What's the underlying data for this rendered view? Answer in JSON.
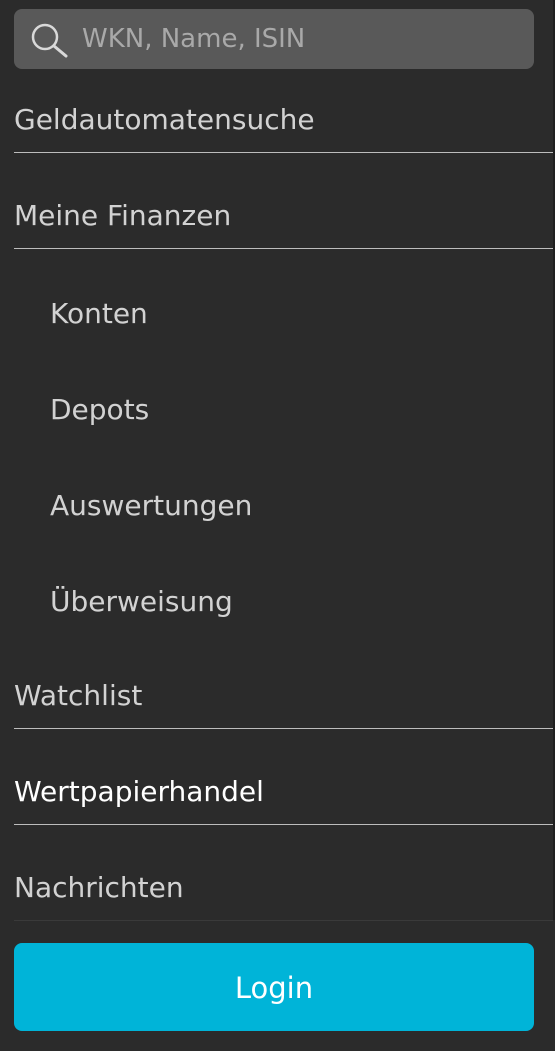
{
  "search": {
    "placeholder": "WKN, Name, ISIN",
    "icon": "search-icon"
  },
  "nav": {
    "items": [
      {
        "label": "Geldautomatensuche",
        "level": 1
      },
      {
        "label": "Meine Finanzen",
        "level": 1
      },
      {
        "label": "Konten",
        "level": 2
      },
      {
        "label": "Depots",
        "level": 2
      },
      {
        "label": "Auswertungen",
        "level": 2
      },
      {
        "label": "Überweisung",
        "level": 2
      },
      {
        "label": "Watchlist",
        "level": 1
      },
      {
        "label": "Wertpapierhandel",
        "level": 1,
        "active": true
      },
      {
        "label": "Nachrichten",
        "level": 1
      }
    ]
  },
  "login": {
    "label": "Login"
  },
  "colors": {
    "background": "#2b2b2b",
    "search_field": "#595959",
    "text": "#d2d2d2",
    "active_text": "#ffffff",
    "accent": "#00b4d8"
  }
}
